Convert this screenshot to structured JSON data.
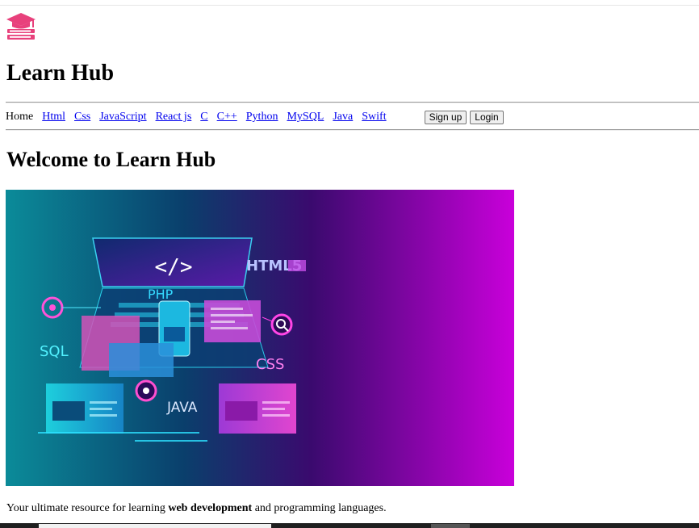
{
  "site": {
    "title": "Learn Hub"
  },
  "nav": {
    "home": "Home",
    "links": [
      "Html",
      "Css",
      "JavaScript",
      "React js",
      "C",
      "C++",
      "Python",
      "MySQL",
      "Java",
      "Swift"
    ],
    "signup": "Sign up",
    "login": "Login"
  },
  "main": {
    "heading": "Welcome to Learn Hub",
    "hero": {
      "html5": "HTML5",
      "php": "PHP",
      "sql": "SQL",
      "css": "CSS",
      "java": "JAVA",
      "code": "</>"
    },
    "tagline_before": "Your ultimate resource for learning ",
    "tagline_bold": "web development",
    "tagline_after": " and programming languages."
  },
  "colors": {
    "link": "#0000ee",
    "logo": "#e8417c",
    "hero_left": "#0a8a96",
    "hero_right": "#c400d6"
  }
}
